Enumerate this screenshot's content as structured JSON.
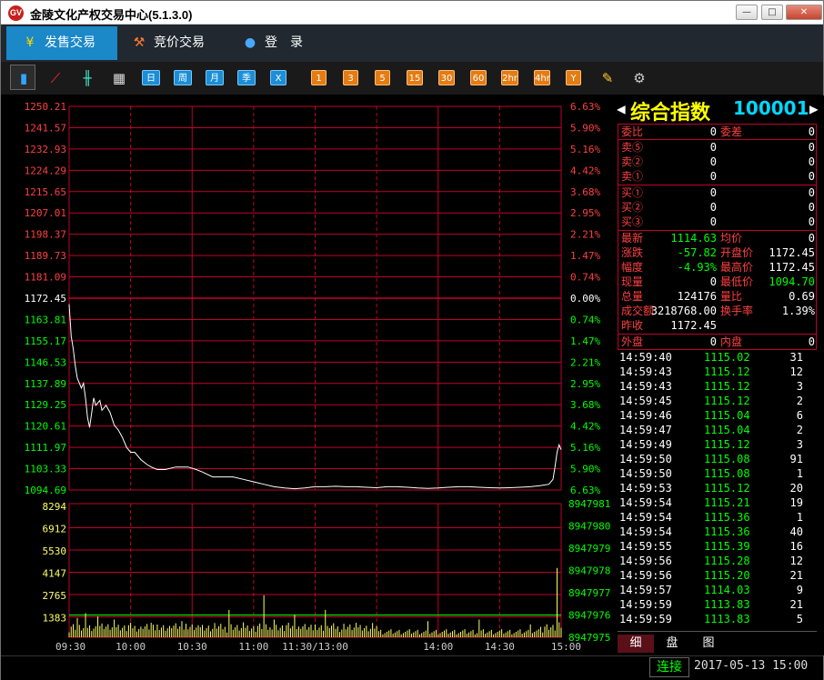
{
  "window": {
    "title": "金陵文化产权交易中心(5.1.3.0)",
    "logo": "GV",
    "minimize": "—",
    "maximize": "□",
    "close": "✕"
  },
  "nav": {
    "sell": "发售交易",
    "auction": "竞价交易",
    "login": "登　录"
  },
  "toolbar": {
    "icons": [
      "bar-chart-icon",
      "line-chart-icon",
      "candlestick-icon",
      "calendar-icon"
    ],
    "periods": [
      "日",
      "周",
      "月",
      "季",
      "X"
    ],
    "minutes": [
      "1",
      "3",
      "5",
      "15",
      "30",
      "60",
      "2hr",
      "4hr",
      "Y"
    ],
    "extra_icons": [
      "draw-pencil-icon",
      "settings-gear-icon"
    ]
  },
  "quote": {
    "name": "综合指数",
    "code": "100001",
    "prev": "◀",
    "next": "▶",
    "wei_bi_label": "委比",
    "wei_bi": "0",
    "wei_cha_label": "委差",
    "wei_cha": "0",
    "asks": [
      {
        "label": "卖⑤",
        "price": "0",
        "vol": "0"
      },
      {
        "label": "卖②",
        "price": "0",
        "vol": "0"
      },
      {
        "label": "卖①",
        "price": "0",
        "vol": "0"
      }
    ],
    "bids": [
      {
        "label": "买①",
        "price": "0",
        "vol": "0"
      },
      {
        "label": "买②",
        "price": "0",
        "vol": "0"
      },
      {
        "label": "买③",
        "price": "0",
        "vol": "0"
      }
    ],
    "stats": [
      {
        "l1": "最新",
        "v1": "1114.63",
        "l2": "均价",
        "v2": "0"
      },
      {
        "l1": "涨跌",
        "v1": "-57.82",
        "l2": "开盘价",
        "v2": "1172.45"
      },
      {
        "l1": "幅度",
        "v1": "-4.93%",
        "l2": "最高价",
        "v2": "1172.45"
      },
      {
        "l1": "现量",
        "v1": "0",
        "l2": "最低价",
        "v2": "1094.70"
      },
      {
        "l1": "总量",
        "v1": "124176",
        "l2": "量比",
        "v2": "0.69"
      },
      {
        "l1": "成交额",
        "v1": "3218768.00",
        "l2": "换手率",
        "v2": "1.39%"
      },
      {
        "l1": "昨收",
        "v1": "1172.45",
        "l2": "",
        "v2": ""
      }
    ],
    "wai_pan_label": "外盘",
    "wai_pan": "0",
    "nei_pan_label": "内盘",
    "nei_pan": "0",
    "ticks": [
      {
        "t": "14:59:40",
        "p": "1115.02",
        "v": "31"
      },
      {
        "t": "14:59:43",
        "p": "1115.12",
        "v": "12"
      },
      {
        "t": "14:59:43",
        "p": "1115.12",
        "v": "3"
      },
      {
        "t": "14:59:45",
        "p": "1115.12",
        "v": "2"
      },
      {
        "t": "14:59:46",
        "p": "1115.04",
        "v": "6"
      },
      {
        "t": "14:59:47",
        "p": "1115.04",
        "v": "2"
      },
      {
        "t": "14:59:49",
        "p": "1115.12",
        "v": "3"
      },
      {
        "t": "14:59:50",
        "p": "1115.08",
        "v": "91"
      },
      {
        "t": "14:59:50",
        "p": "1115.08",
        "v": "1"
      },
      {
        "t": "14:59:53",
        "p": "1115.12",
        "v": "20"
      },
      {
        "t": "14:59:54",
        "p": "1115.21",
        "v": "19"
      },
      {
        "t": "14:59:54",
        "p": "1115.36",
        "v": "1"
      },
      {
        "t": "14:59:54",
        "p": "1115.36",
        "v": "40"
      },
      {
        "t": "14:59:55",
        "p": "1115.39",
        "v": "16"
      },
      {
        "t": "14:59:56",
        "p": "1115.28",
        "v": "12"
      },
      {
        "t": "14:59:56",
        "p": "1115.20",
        "v": "21"
      },
      {
        "t": "14:59:57",
        "p": "1114.03",
        "v": "9"
      },
      {
        "t": "14:59:59",
        "p": "1113.83",
        "v": "21"
      },
      {
        "t": "14:59:59",
        "p": "1113.83",
        "v": "5"
      }
    ],
    "tabs": [
      "细",
      "盘",
      "图"
    ]
  },
  "status": {
    "connection": "连接",
    "datetime": "2017-05-13 15:00"
  },
  "chart_data": {
    "type": "line",
    "prev_close": 1172.45,
    "price_ticks": [
      "1250.21",
      "1241.57",
      "1232.93",
      "1224.29",
      "1215.65",
      "1207.01",
      "1198.37",
      "1189.73",
      "1181.09",
      "1172.45",
      "1163.81",
      "1155.17",
      "1146.53",
      "1137.89",
      "1129.25",
      "1120.61",
      "1111.97",
      "1103.33",
      "1094.69"
    ],
    "pct_ticks": [
      "6.63%",
      "5.90%",
      "5.16%",
      "4.42%",
      "3.68%",
      "2.95%",
      "2.21%",
      "1.47%",
      "0.74%",
      "0.00%",
      "0.74%",
      "1.47%",
      "2.21%",
      "2.95%",
      "3.68%",
      "4.42%",
      "5.16%",
      "5.90%",
      "6.63%"
    ],
    "ylim": [
      1094.69,
      1250.21
    ],
    "time_ticks": [
      "09:30",
      "10:00",
      "10:30",
      "11:00",
      "11:30/13:00",
      "14:00",
      "14:30",
      "15:00"
    ],
    "volume_ticks_left": [
      "8294",
      "6912",
      "5530",
      "4147",
      "2765",
      "1383"
    ],
    "volume_ticks_right": [
      "8947981",
      "8947980",
      "8947979",
      "8947978",
      "8947977",
      "8947976",
      "8947975"
    ],
    "volume_max": 8294,
    "minutes_total": 240,
    "price_series": [
      [
        0,
        1170
      ],
      [
        1,
        1157
      ],
      [
        2,
        1152
      ],
      [
        3,
        1145
      ],
      [
        4,
        1140
      ],
      [
        5,
        1138
      ],
      [
        6,
        1136
      ],
      [
        7,
        1138
      ],
      [
        8,
        1132
      ],
      [
        9,
        1124
      ],
      [
        10,
        1120
      ],
      [
        11,
        1126
      ],
      [
        12,
        1132
      ],
      [
        13,
        1129
      ],
      [
        15,
        1131
      ],
      [
        16,
        1127
      ],
      [
        18,
        1129
      ],
      [
        20,
        1126
      ],
      [
        22,
        1121
      ],
      [
        24,
        1119
      ],
      [
        26,
        1116
      ],
      [
        28,
        1112
      ],
      [
        30,
        1110
      ],
      [
        32,
        1110
      ],
      [
        35,
        1107
      ],
      [
        38,
        1105
      ],
      [
        40,
        1104
      ],
      [
        43,
        1103
      ],
      [
        47,
        1103
      ],
      [
        52,
        1104
      ],
      [
        58,
        1104
      ],
      [
        62,
        1103
      ],
      [
        65,
        1102
      ],
      [
        70,
        1100
      ],
      [
        75,
        1100
      ],
      [
        80,
        1100
      ],
      [
        85,
        1099
      ],
      [
        90,
        1098
      ],
      [
        95,
        1097
      ],
      [
        100,
        1096
      ],
      [
        105,
        1095.5
      ],
      [
        110,
        1095.2
      ],
      [
        115,
        1095.5
      ],
      [
        120,
        1096
      ],
      [
        125,
        1096
      ],
      [
        130,
        1096.2
      ],
      [
        135,
        1096
      ],
      [
        140,
        1096
      ],
      [
        145,
        1095.8
      ],
      [
        150,
        1095.6
      ],
      [
        155,
        1096
      ],
      [
        160,
        1096
      ],
      [
        165,
        1095.8
      ],
      [
        170,
        1095.5
      ],
      [
        175,
        1095.3
      ],
      [
        180,
        1095.5
      ],
      [
        185,
        1095.8
      ],
      [
        190,
        1096
      ],
      [
        195,
        1096
      ],
      [
        200,
        1095.8
      ],
      [
        205,
        1095.6
      ],
      [
        210,
        1095.5
      ],
      [
        215,
        1095.6
      ],
      [
        220,
        1095.8
      ],
      [
        225,
        1096
      ],
      [
        230,
        1096.5
      ],
      [
        234,
        1097
      ],
      [
        236,
        1099
      ],
      [
        237,
        1104
      ],
      [
        238,
        1110
      ],
      [
        239,
        1113
      ],
      [
        240,
        1111
      ]
    ],
    "volume_spikes": [
      [
        4,
        1200
      ],
      [
        8,
        1500
      ],
      [
        14,
        1300
      ],
      [
        22,
        1100
      ],
      [
        40,
        900
      ],
      [
        55,
        1000
      ],
      [
        78,
        1700
      ],
      [
        95,
        2600
      ],
      [
        100,
        1100
      ],
      [
        110,
        1400
      ],
      [
        125,
        1700
      ],
      [
        140,
        900
      ],
      [
        175,
        1000
      ],
      [
        200,
        1100
      ],
      [
        225,
        800
      ],
      [
        238,
        4300
      ]
    ]
  }
}
